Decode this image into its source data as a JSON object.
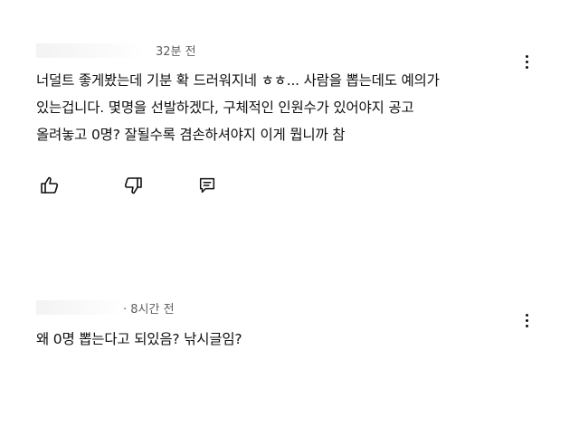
{
  "comments": [
    {
      "timestamp": "32분 전",
      "lines": [
        "너덜트 좋게봤는데 기분 확 드러워지네 ㅎㅎ... 사람을 뽑는데도 예의가",
        "있는겁니다. 몇명을 선발하겠다, 구체적인 인원수가 있어야지 공고",
        "올려놓고 0명? 잘될수록 겸손하셔야지 이게 뭡니까 참"
      ],
      "actions": [
        "thumb-up-icon",
        "thumb-down-icon",
        "reply-icon"
      ]
    },
    {
      "timestamp": "· 8시간 전",
      "lines": [
        "왜 0명 뽑는다고 되있음? 낚시글임?"
      ]
    }
  ],
  "icons": {
    "more": "more-vertical-icon"
  }
}
